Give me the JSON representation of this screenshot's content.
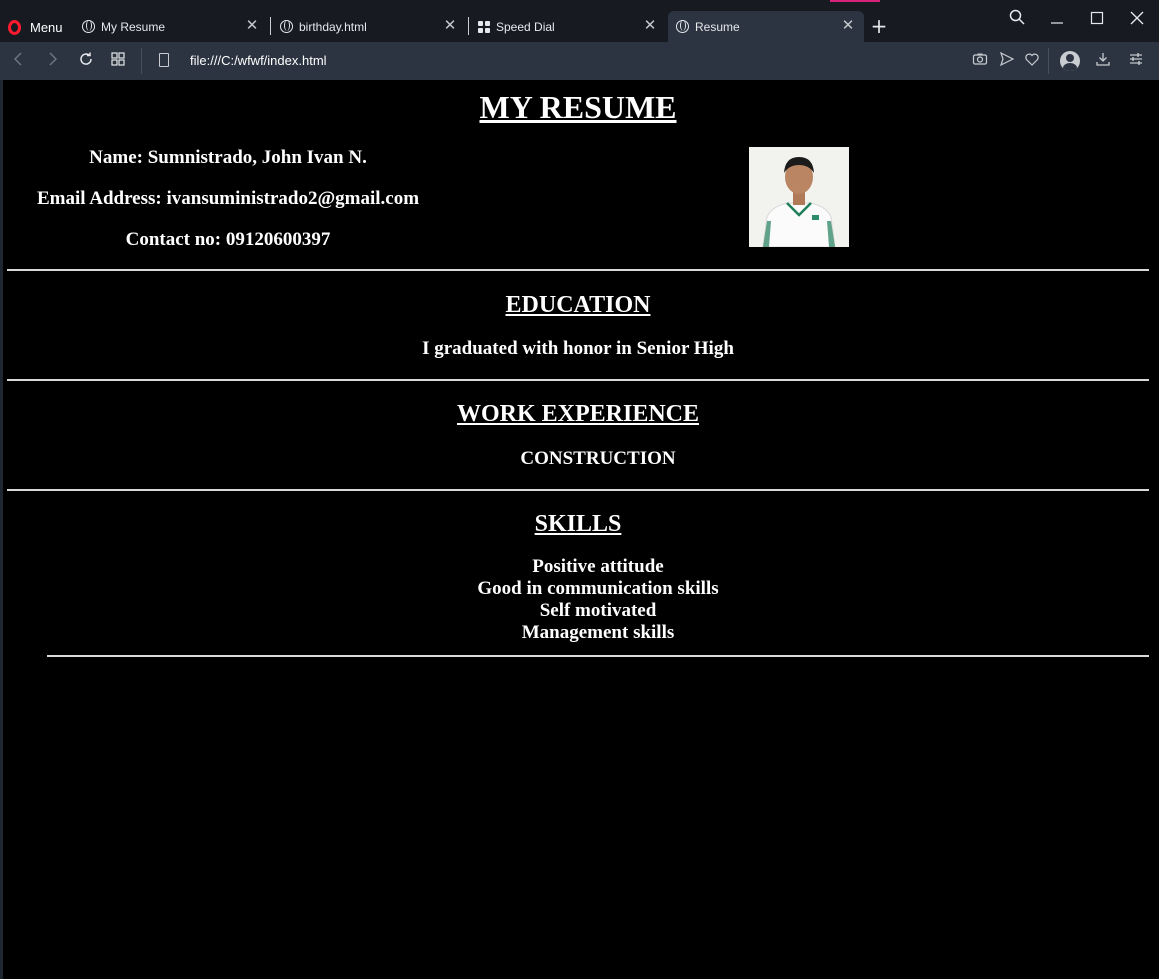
{
  "browser": {
    "menu_label": "Menu",
    "tabs": [
      {
        "label": "My Resume",
        "active": false
      },
      {
        "label": "birthday.html",
        "active": false
      },
      {
        "label": "Speed Dial",
        "active": false
      },
      {
        "label": "Resume",
        "active": true
      }
    ],
    "url": "file:///C:/wfwf/index.html",
    "accent_color": "#ff1b2d"
  },
  "resume": {
    "title": "MY RESUME",
    "name_line": "Name: Sumnistrado, John Ivan N.",
    "email_line": "Email Address: ivansuministrado2@gmail.com",
    "contact_line": "Contact no: 09120600397",
    "education": {
      "heading": "EDUCATION",
      "text": "I graduated with honor in Senior High"
    },
    "work": {
      "heading": "WORK EXPERIENCE",
      "text": "CONSTRUCTION"
    },
    "skills": {
      "heading": "SKILLS",
      "items": [
        "Positive attitude",
        "Good in communication skills",
        "Self motivated",
        "Management skills"
      ]
    }
  }
}
